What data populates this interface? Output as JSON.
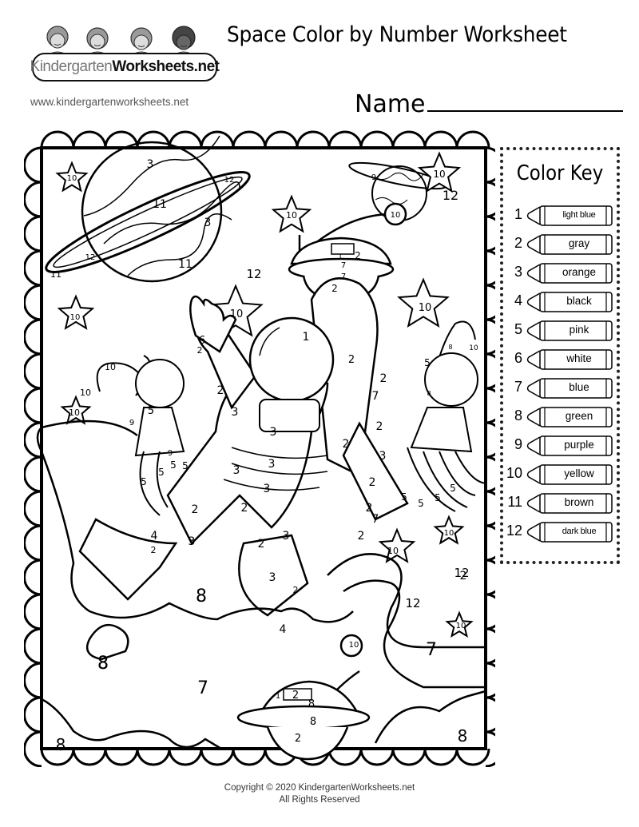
{
  "header": {
    "logo_text_part1": "Kindergarten",
    "logo_text_part2": "Worksheets.net",
    "site_url": "www.kindergartenworksheets.net",
    "title": "Space Color by Number Worksheet",
    "name_label": "Name"
  },
  "color_key": {
    "title": "Color Key",
    "items": [
      {
        "number": "1",
        "color": "light blue"
      },
      {
        "number": "2",
        "color": "gray"
      },
      {
        "number": "3",
        "color": "orange"
      },
      {
        "number": "4",
        "color": "black"
      },
      {
        "number": "5",
        "color": "pink"
      },
      {
        "number": "6",
        "color": "white"
      },
      {
        "number": "7",
        "color": "blue"
      },
      {
        "number": "8",
        "color": "green"
      },
      {
        "number": "9",
        "color": "purple"
      },
      {
        "number": "10",
        "color": "yellow"
      },
      {
        "number": "11",
        "color": "brown"
      },
      {
        "number": "12",
        "color": "dark blue"
      }
    ]
  },
  "picture": {
    "regions": [
      {
        "id": "big-planet-top-band",
        "label": "3"
      },
      {
        "id": "big-planet-middle-band",
        "label": "11"
      },
      {
        "id": "big-planet-lower-band",
        "label": "3"
      },
      {
        "id": "big-planet-bottom-band",
        "label": "11"
      },
      {
        "id": "big-planet-ring-right",
        "label": "12"
      },
      {
        "id": "big-planet-ring-left",
        "label": "12"
      },
      {
        "id": "big-planet-ring-tip",
        "label": "11"
      },
      {
        "id": "star-top-left",
        "label": "10"
      },
      {
        "id": "small-planet",
        "label": "9"
      },
      {
        "id": "star-top-right",
        "label": "10"
      },
      {
        "id": "star-center-top",
        "label": "10"
      },
      {
        "id": "ufo-top-antenna-ball",
        "label": "10"
      },
      {
        "id": "sky-top-right",
        "label": "12"
      },
      {
        "id": "ufo-top-window",
        "label": "1"
      },
      {
        "id": "ufo-top-dome-side",
        "label": "2"
      },
      {
        "id": "ufo-top-rim",
        "label": "7"
      },
      {
        "id": "ufo-top-rim-lower",
        "label": "7"
      },
      {
        "id": "ufo-top-base",
        "label": "2"
      },
      {
        "id": "sky-center",
        "label": "12"
      },
      {
        "id": "star-left",
        "label": "10"
      },
      {
        "id": "star-center",
        "label": "10"
      },
      {
        "id": "star-right",
        "label": "10"
      },
      {
        "id": "astronaut-helmet",
        "label": "1"
      },
      {
        "id": "astronaut-glove-left",
        "label": "6"
      },
      {
        "id": "astronaut-cuff-left",
        "label": "2"
      },
      {
        "id": "astronaut-arm-left",
        "label": "2"
      },
      {
        "id": "astronaut-arm-left-band",
        "label": "3"
      },
      {
        "id": "astronaut-collar",
        "label": "2"
      },
      {
        "id": "astronaut-chest-panel",
        "label": "3"
      },
      {
        "id": "astronaut-torso",
        "label": "2"
      },
      {
        "id": "astronaut-torso-stripe-1",
        "label": "3"
      },
      {
        "id": "astronaut-torso-stripe-2",
        "label": "3"
      },
      {
        "id": "astronaut-torso-lower",
        "label": "2"
      },
      {
        "id": "astronaut-arm-right",
        "label": "2"
      },
      {
        "id": "astronaut-arm-right-band",
        "label": "3"
      },
      {
        "id": "astronaut-arm-right-lower",
        "label": "2"
      },
      {
        "id": "jetpack",
        "label": "2"
      },
      {
        "id": "jetpack-stripe",
        "label": "7"
      },
      {
        "id": "jetpack-lower",
        "label": "2"
      },
      {
        "id": "jetpack-bottom-stripe",
        "label": "7"
      },
      {
        "id": "jetpack-bottom",
        "label": "2"
      },
      {
        "id": "alien-left-antenna-1",
        "label": "10"
      },
      {
        "id": "alien-left-antenna-2",
        "label": "10"
      },
      {
        "id": "alien-left-face",
        "label": "5"
      },
      {
        "id": "alien-left-helmet",
        "label": "9"
      },
      {
        "id": "alien-left-body",
        "label": "9"
      },
      {
        "id": "alien-left-tentacle-1",
        "label": "5"
      },
      {
        "id": "alien-left-tentacle-2",
        "label": "5"
      },
      {
        "id": "alien-left-tentacle-3",
        "label": "5"
      },
      {
        "id": "alien-left-tentacle-4",
        "label": "5"
      },
      {
        "id": "star-left-lower",
        "label": "10"
      },
      {
        "id": "alien-right-antenna",
        "label": "10"
      },
      {
        "id": "alien-right-face",
        "label": "5"
      },
      {
        "id": "alien-right-helmet",
        "label": "8"
      },
      {
        "id": "alien-right-body",
        "label": "8"
      },
      {
        "id": "alien-right-tentacle-1",
        "label": "5"
      },
      {
        "id": "alien-right-tentacle-2",
        "label": "5"
      },
      {
        "id": "alien-right-tentacle-3",
        "label": "5"
      },
      {
        "id": "alien-right-tentacle-4",
        "label": "5"
      },
      {
        "id": "astronaut-leg-left",
        "label": "2"
      },
      {
        "id": "astronaut-leg-left-band",
        "label": "3"
      },
      {
        "id": "astronaut-leg-left-upper",
        "label": "3"
      },
      {
        "id": "astronaut-boot-left",
        "label": "4"
      },
      {
        "id": "astronaut-boot-left-trim",
        "label": "2"
      },
      {
        "id": "astronaut-leg-right-band",
        "label": "3"
      },
      {
        "id": "astronaut-leg-right",
        "label": "2"
      },
      {
        "id": "astronaut-leg-right-lower",
        "label": "3"
      },
      {
        "id": "astronaut-boot-right-trim",
        "label": "2"
      },
      {
        "id": "astronaut-boot-right",
        "label": "4"
      },
      {
        "id": "star-lower-right-1",
        "label": "10"
      },
      {
        "id": "star-lower-right-2",
        "label": "10"
      },
      {
        "id": "star-lower-right-3",
        "label": "10"
      },
      {
        "id": "ground-center",
        "label": "8"
      },
      {
        "id": "ground-left",
        "label": "8"
      },
      {
        "id": "sky-lower-right",
        "label": "12"
      },
      {
        "id": "sky-tether-gap",
        "label": "12"
      },
      {
        "id": "tether",
        "label": "2"
      },
      {
        "id": "sky-lower-right-corner",
        "label": "7"
      },
      {
        "id": "crater",
        "label": "8"
      },
      {
        "id": "sky-bottom",
        "label": "7"
      },
      {
        "id": "ufo-bottom-antenna-ball",
        "label": "10"
      },
      {
        "id": "ufo-bottom-window",
        "label": "1"
      },
      {
        "id": "ufo-bottom-dome-side",
        "label": "2"
      },
      {
        "id": "ufo-bottom-dome",
        "label": "8"
      },
      {
        "id": "ufo-bottom-rim",
        "label": "8"
      },
      {
        "id": "ufo-bottom-base",
        "label": "2"
      },
      {
        "id": "ground-bottom-left",
        "label": "8"
      },
      {
        "id": "ground-bottom-right",
        "label": "8"
      }
    ]
  },
  "footer": {
    "copyright": "Copyright © 2020 KindergartenWorksheets.net",
    "rights": "All Rights Reserved"
  }
}
